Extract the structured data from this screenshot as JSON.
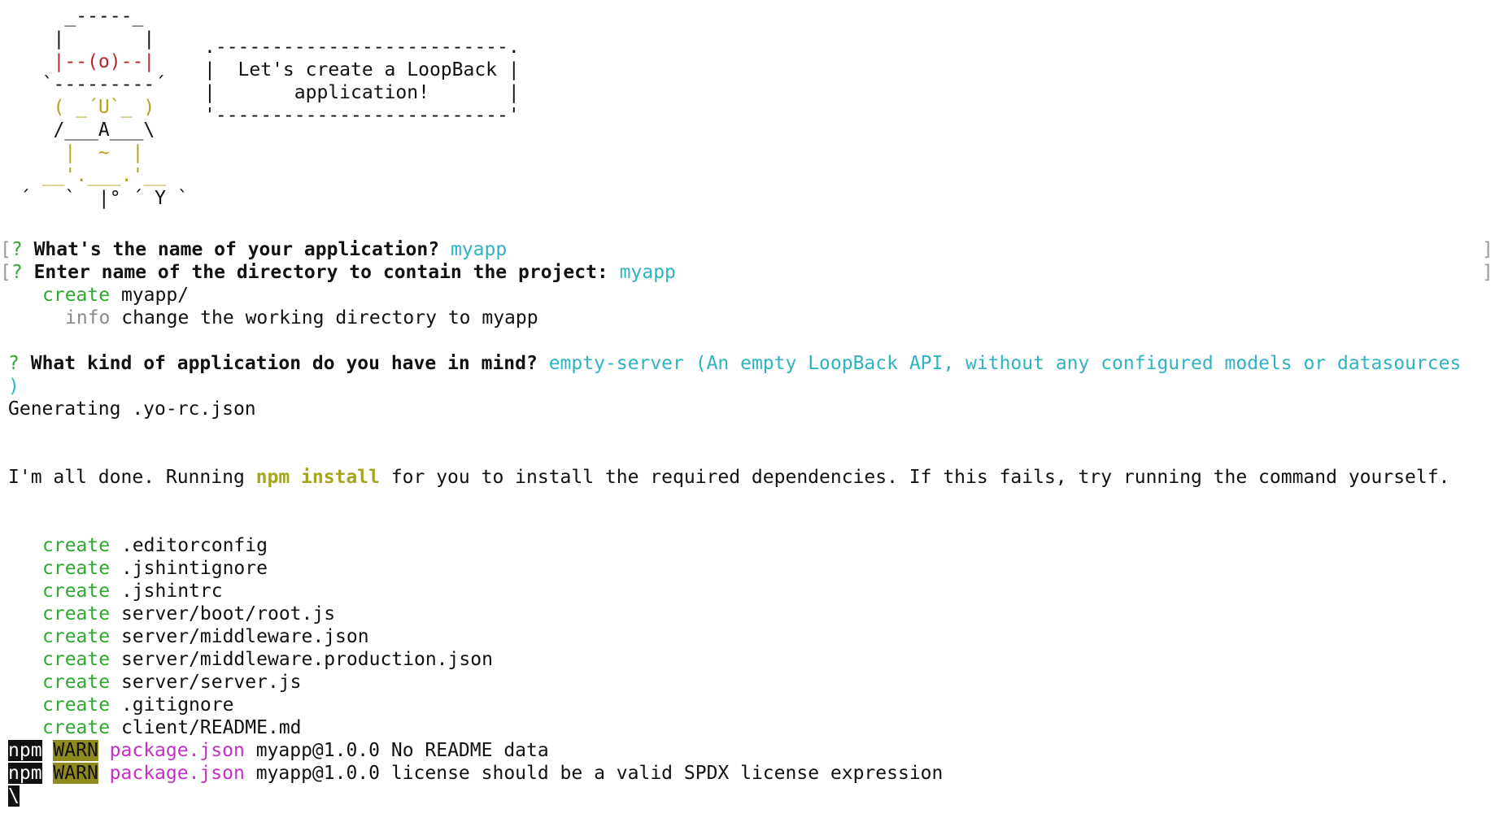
{
  "banner": {
    "yeoman": [
      "    _-----_     ",
      "   |       |    ",
      "   |--(o)--|    ",
      "  `---------´   ",
      "   ( _´U`_ )    ",
      "   /___A___\\   ",
      "    |  ~  |     ",
      "  __'.___.'__   ",
      "´   `  |° ´ Y ` "
    ],
    "speech_bubble": [
      ".--------------------------.",
      "|  Let's create a LoopBack |",
      "|       application!       |",
      "'--------------------------'"
    ]
  },
  "prompts": {
    "q_mark": "?",
    "name_question": "What's the name of your application?",
    "name_answer": "myapp",
    "dir_question": "Enter name of the directory to contain the project:",
    "dir_answer": "myapp",
    "kind_question": "What kind of application do you have in mind?",
    "kind_answer": "empty-server (An empty LoopBack API, without any configured models or datasources",
    "kind_answer_wrap": ")"
  },
  "setup_log": {
    "create_label": "create",
    "create_path": "myapp/",
    "info_label": "info",
    "info_text": "change the working directory to myapp"
  },
  "generating": "Generating .yo-rc.json",
  "done_message": {
    "before": "I'm all done. Running ",
    "highlight": "npm install",
    "after": " for you to install the required dependencies. If this fails, try running the command yourself."
  },
  "created_files": [
    {
      "verb": "create",
      "path": ".editorconfig"
    },
    {
      "verb": "create",
      "path": ".jshintignore"
    },
    {
      "verb": "create",
      "path": ".jshintrc"
    },
    {
      "verb": "create",
      "path": "server/boot/root.js"
    },
    {
      "verb": "create",
      "path": "server/middleware.json"
    },
    {
      "verb": "create",
      "path": "server/middleware.production.json"
    },
    {
      "verb": "create",
      "path": "server/server.js"
    },
    {
      "verb": "create",
      "path": ".gitignore"
    },
    {
      "verb": "create",
      "path": "client/README.md"
    }
  ],
  "npm_warnings": [
    {
      "tag": "npm",
      "level": "WARN",
      "source": "package.json",
      "message": "myapp@1.0.0 No README data"
    },
    {
      "tag": "npm",
      "level": "WARN",
      "source": "package.json",
      "message": "myapp@1.0.0 license should be a valid SPDX license expression"
    }
  ],
  "cursor_char": "\\",
  "colors": {
    "green": "#2ea82e",
    "cyan": "#2fb3c2",
    "red": "#b8262b",
    "yellow": "#b5a21f",
    "magenta": "#c72ec7",
    "warn_bg": "#8f8a1e"
  }
}
